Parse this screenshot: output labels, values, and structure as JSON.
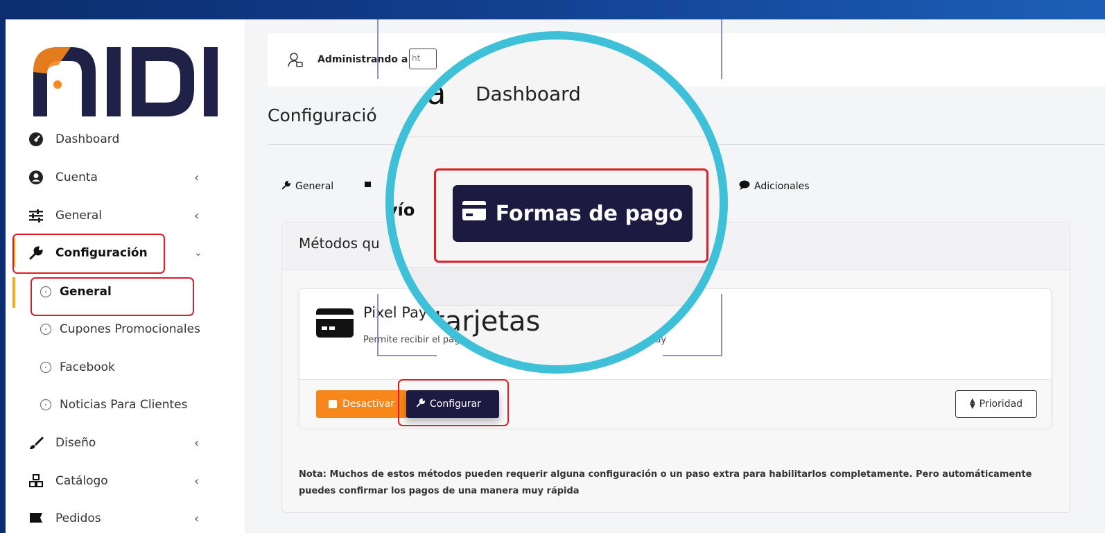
{
  "sidebar": {
    "logo_text": "NIDI",
    "items": [
      {
        "label": "Dashboard",
        "icon": "gauge-icon"
      },
      {
        "label": "Cuenta",
        "icon": "user-circle-icon"
      },
      {
        "label": "General",
        "icon": "sliders-icon"
      },
      {
        "label": "Configuración",
        "icon": "wrench-icon"
      },
      {
        "label": "General",
        "icon": "circle-icon"
      },
      {
        "label": "Cupones Promocionales",
        "icon": "circle-icon"
      },
      {
        "label": "Facebook",
        "icon": "circle-icon"
      },
      {
        "label": "Noticias Para Clientes",
        "icon": "circle-icon"
      },
      {
        "label": "Diseño",
        "icon": "brush-icon"
      },
      {
        "label": "Catálogo",
        "icon": "cubes-icon"
      },
      {
        "label": "Pedidos",
        "icon": "flag-icon"
      }
    ]
  },
  "topbar": {
    "admin_label": "Administrando a",
    "url_text": "ht"
  },
  "page": {
    "title": "Configuració"
  },
  "tabs": {
    "general": "General",
    "envio": "vío",
    "adicionales": "Adicionales"
  },
  "card": {
    "header": "Métodos qu",
    "method_name": "Pixel Pay",
    "method_desc_left": "Permite recibir el pag",
    "method_desc_right": "Pixel Pay",
    "deactivate": "Desactivar",
    "configure": "Configurar",
    "priority": "Prioridad",
    "note": "Nota: Muchos de estos métodos pueden requerir alguna configuración o un paso extra para habilitarlos completamente. Pero automáticamente puedes confirmar los pagos de una manera muy rápida"
  },
  "magnifier": {
    "top_text_frag": "da",
    "top_text": "Dashboard",
    "pay_button": "Formas de pago",
    "bottom_text": "tarjetas"
  },
  "colors": {
    "accent_dark": "#1d1a42",
    "orange": "#f7861b",
    "highlight_red": "#e31b23",
    "magnifier_ring": "#3fc0d9"
  }
}
